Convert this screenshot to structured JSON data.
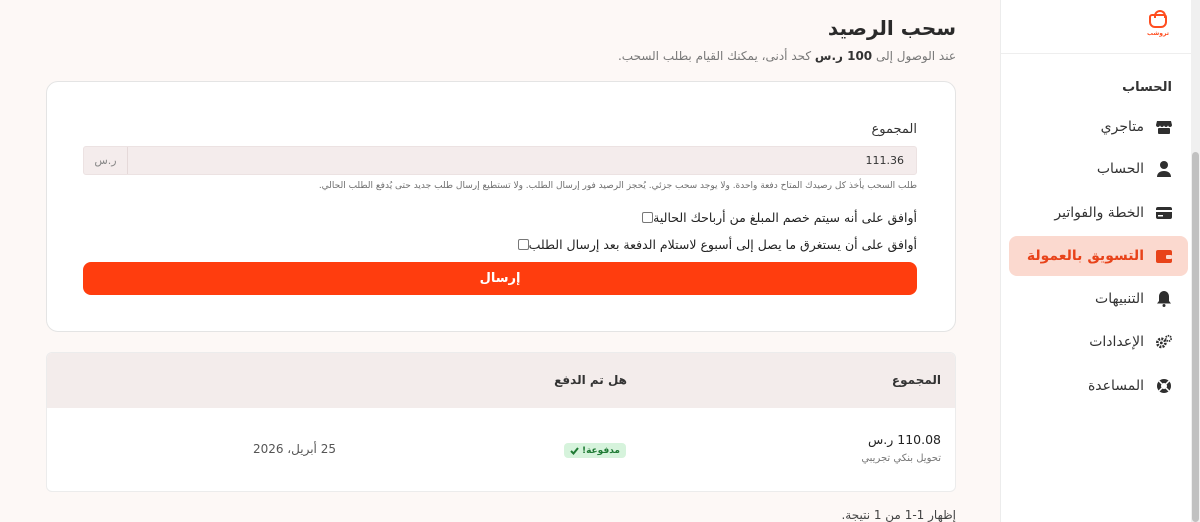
{
  "brand": {
    "logo_text": "تروشب"
  },
  "sidebar": {
    "section_title": "الحساب",
    "items": [
      {
        "label": "متاجري",
        "icon": "store-icon",
        "active": false
      },
      {
        "label": "الحساب",
        "icon": "user-icon",
        "active": false
      },
      {
        "label": "الخطة والفواتير",
        "icon": "credit-card-icon",
        "active": false
      },
      {
        "label": "التسويق بالعمولة",
        "icon": "wallet-icon",
        "active": true
      },
      {
        "label": "التنبيهات",
        "icon": "bell-icon",
        "active": false
      },
      {
        "label": "الإعدادات",
        "icon": "gears-icon",
        "active": false
      },
      {
        "label": "المساعدة",
        "icon": "lifebuoy-icon",
        "active": false
      }
    ]
  },
  "page": {
    "title": "سحب الرصيد",
    "subtitle_prefix": "عند الوصول إلى",
    "subtitle_amount": "100 ر.س",
    "subtitle_suffix": "كحد أدنى، يمكنك القيام بطلب السحب."
  },
  "form": {
    "total_label": "المجموع",
    "amount_value": "111.36",
    "amount_unit": "ر.س",
    "hint": "طلب السحب يأخذ كل رصيدك المتاح دفعة واحدة. ولا يوجد سحب جزئي. يُحجز الرصيد فور إرسال الطلب. ولا تستطيع إرسال طلب جديد حتى يُدفع الطلب الحالي.",
    "agree_deduct": "أوافق على أنه سيتم خصم المبلغ من أرباحك الحالية",
    "agree_week": "أوافق على أن يستغرق ما يصل إلى أسبوع لاستلام الدفعة بعد إرسال الطلب",
    "submit_label": "إرسال"
  },
  "table": {
    "columns": [
      "المجموع",
      "هل تم الدفع",
      ""
    ],
    "rows": [
      {
        "amount": "110.08 ر.س",
        "method": "تحويل بنكي تجريبي",
        "status": "مدفوعة!",
        "date": "25 أبريل، 2026"
      }
    ]
  },
  "pagination": {
    "summary": "إظهار 1-1 من 1 نتيجة."
  },
  "colors": {
    "accent": "#ff3d0e",
    "active_bg": "#fbd9cf",
    "paid_bg": "#d6f3dc",
    "paid_text": "#1f7a34"
  }
}
